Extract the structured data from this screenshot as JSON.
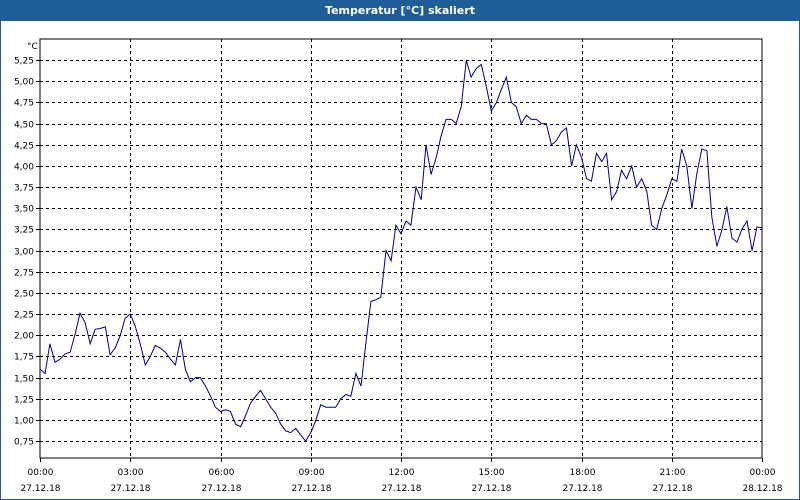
{
  "window": {
    "title": "Temperatur [°C] skaliert"
  },
  "colors": {
    "title_bar": "#1f5d99",
    "series": "#00008b",
    "grid": "#000000"
  },
  "chart_data": {
    "type": "line",
    "title": "Temperatur [°C] skaliert",
    "ylabel": "°C",
    "xlabel": "",
    "ylim": [
      0.55,
      5.5
    ],
    "grid": true,
    "y_ticks": [
      "0,75",
      "1,00",
      "1,25",
      "1,50",
      "1,75",
      "2,00",
      "2,25",
      "2,50",
      "2,75",
      "3,00",
      "3,25",
      "3,50",
      "3,75",
      "4,00",
      "4,25",
      "4,50",
      "4,75",
      "5,00",
      "5,25"
    ],
    "y_tick_values": [
      0.75,
      1.0,
      1.25,
      1.5,
      1.75,
      2.0,
      2.25,
      2.5,
      2.75,
      3.0,
      3.25,
      3.5,
      3.75,
      4.0,
      4.25,
      4.5,
      4.75,
      5.0,
      5.25
    ],
    "x_ticks": [
      {
        "time": "00:00",
        "date": "27.12.18"
      },
      {
        "time": "03:00",
        "date": "27.12.18"
      },
      {
        "time": "06:00",
        "date": "27.12.18"
      },
      {
        "time": "09:00",
        "date": "27.12.18"
      },
      {
        "time": "12:00",
        "date": "27.12.18"
      },
      {
        "time": "15:00",
        "date": "27.12.18"
      },
      {
        "time": "18:00",
        "date": "27.12.18"
      },
      {
        "time": "21:00",
        "date": "27.12.18"
      },
      {
        "time": "00:00",
        "date": "28.12.18"
      }
    ],
    "x_tick_hours": [
      0,
      3,
      6,
      9,
      12,
      15,
      18,
      21,
      24
    ],
    "xlim_hours": [
      0,
      24
    ],
    "series": [
      {
        "x_hours": [
          0.0,
          0.17,
          0.33,
          0.5,
          0.67,
          0.83,
          1.0,
          1.17,
          1.33,
          1.5,
          1.67,
          1.83,
          2.0,
          2.17,
          2.33,
          2.5,
          2.67,
          2.83,
          3.0,
          3.17,
          3.33,
          3.5,
          3.67,
          3.83,
          4.0,
          4.17,
          4.33,
          4.5,
          4.67,
          4.83,
          5.0,
          5.17,
          5.33,
          5.5,
          5.67,
          5.83,
          6.0,
          6.17,
          6.33,
          6.5,
          6.67,
          6.83,
          7.0,
          7.17,
          7.33,
          7.5,
          7.67,
          7.83,
          8.0,
          8.17,
          8.33,
          8.5,
          8.67,
          8.83,
          9.0,
          9.17,
          9.33,
          9.5,
          9.67,
          9.83,
          10.0,
          10.17,
          10.33,
          10.5,
          10.67,
          10.83,
          11.0,
          11.17,
          11.33,
          11.5,
          11.67,
          11.83,
          12.0,
          12.17,
          12.33,
          12.5,
          12.67,
          12.83,
          13.0,
          13.17,
          13.33,
          13.5,
          13.67,
          13.83,
          14.0,
          14.17,
          14.33,
          14.5,
          14.67,
          14.83,
          15.0,
          15.17,
          15.33,
          15.5,
          15.67,
          15.83,
          16.0,
          16.17,
          16.33,
          16.5,
          16.67,
          16.83,
          17.0,
          17.17,
          17.33,
          17.5,
          17.67,
          17.83,
          18.0,
          18.17,
          18.33,
          18.5,
          18.67,
          18.83,
          19.0,
          19.17,
          19.33,
          19.5,
          19.67,
          19.83,
          20.0,
          20.17,
          20.33,
          20.5,
          20.67,
          20.83,
          21.0,
          21.17,
          21.33,
          21.5,
          21.67,
          21.83,
          22.0,
          22.17,
          22.33,
          22.5,
          22.67,
          22.83,
          23.0,
          23.17,
          23.33,
          23.5,
          23.67,
          23.83,
          24.0
        ],
        "values": [
          1.6,
          1.55,
          1.9,
          1.68,
          1.72,
          1.78,
          1.8,
          2.02,
          2.26,
          2.15,
          1.9,
          2.07,
          2.08,
          2.1,
          1.77,
          1.85,
          2.0,
          2.2,
          2.25,
          2.1,
          1.9,
          1.65,
          1.75,
          1.88,
          1.85,
          1.8,
          1.72,
          1.65,
          1.95,
          1.6,
          1.45,
          1.5,
          1.5,
          1.4,
          1.28,
          1.15,
          1.1,
          1.12,
          1.1,
          0.95,
          0.92,
          1.05,
          1.2,
          1.28,
          1.35,
          1.25,
          1.15,
          1.08,
          0.95,
          0.87,
          0.85,
          0.9,
          0.82,
          0.75,
          0.85,
          1.0,
          1.18,
          1.15,
          1.15,
          1.15,
          1.25,
          1.3,
          1.28,
          1.55,
          1.4,
          1.9,
          2.4,
          2.42,
          2.45,
          3.0,
          2.88,
          3.3,
          3.2,
          3.35,
          3.3,
          3.75,
          3.6,
          4.25,
          3.9,
          4.1,
          4.35,
          4.55,
          4.55,
          4.5,
          4.7,
          5.25,
          5.05,
          5.15,
          5.2,
          4.95,
          4.65,
          4.75,
          4.9,
          5.05,
          4.75,
          4.7,
          4.5,
          4.6,
          4.55,
          4.55,
          4.5,
          4.5,
          4.25,
          4.3,
          4.4,
          4.45,
          4.0,
          4.25,
          4.1,
          3.85,
          3.82,
          4.15,
          4.05,
          4.15,
          3.6,
          3.7,
          3.95,
          3.85,
          4.0,
          3.75,
          3.85,
          3.7,
          3.3,
          3.25,
          3.5,
          3.65,
          3.85,
          3.82,
          4.2,
          4.0,
          3.5,
          3.9,
          4.2,
          4.18,
          3.4,
          3.05,
          3.25,
          3.52,
          3.15,
          3.1,
          3.25,
          3.35,
          3.0,
          3.28,
          3.27
        ]
      }
    ]
  }
}
